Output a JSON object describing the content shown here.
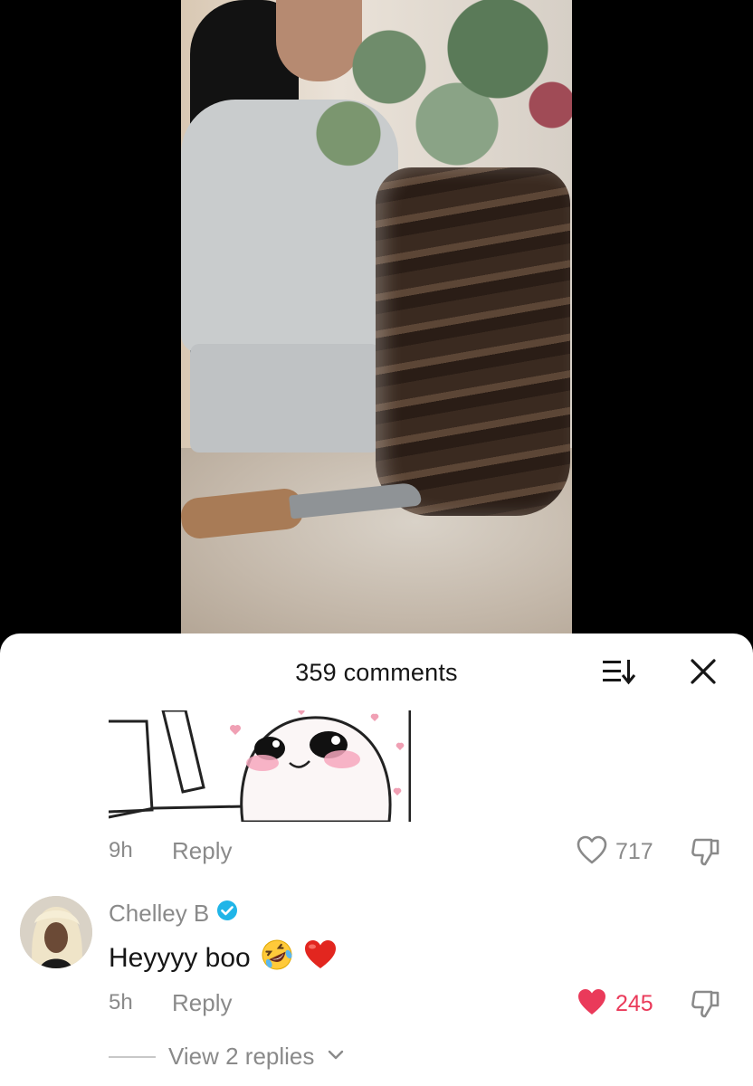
{
  "comments_panel": {
    "count_label": "359 comments"
  },
  "comments": [
    {
      "time": "9h",
      "reply_label": "Reply",
      "likes": "717",
      "liked": false
    },
    {
      "username": "Chelley B",
      "verified": true,
      "text": "Heyyyy boo",
      "emojis": [
        "rolling-on-floor-laughing",
        "red-heart"
      ],
      "time": "5h",
      "reply_label": "Reply",
      "likes": "245",
      "liked": true,
      "view_replies": "View 2 replies"
    }
  ],
  "colors": {
    "like_active": "#ea3a5a",
    "verified": "#20b5e8",
    "muted_text": "#8a8a8a"
  }
}
